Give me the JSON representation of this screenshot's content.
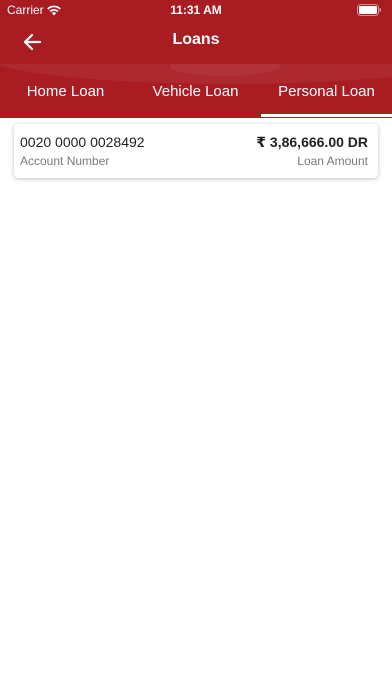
{
  "status_bar": {
    "carrier": "Carrier",
    "time": "11:31 AM"
  },
  "header": {
    "title": "Loans",
    "back_icon": "arrow-left-icon"
  },
  "tabs": [
    {
      "label": "Home Loan",
      "selected": false
    },
    {
      "label": "Vehicle Loan",
      "selected": false
    },
    {
      "label": "Personal Loan",
      "selected": true
    }
  ],
  "loans": [
    {
      "account_number": "0020 0000 0028492",
      "account_label": "Account Number",
      "amount": "₹ 3,86,666.00 DR",
      "amount_label": "Loan Amount"
    }
  ],
  "colors": {
    "brand": "#a81c22",
    "text_primary": "#222222",
    "text_secondary": "#7a7a7a"
  }
}
